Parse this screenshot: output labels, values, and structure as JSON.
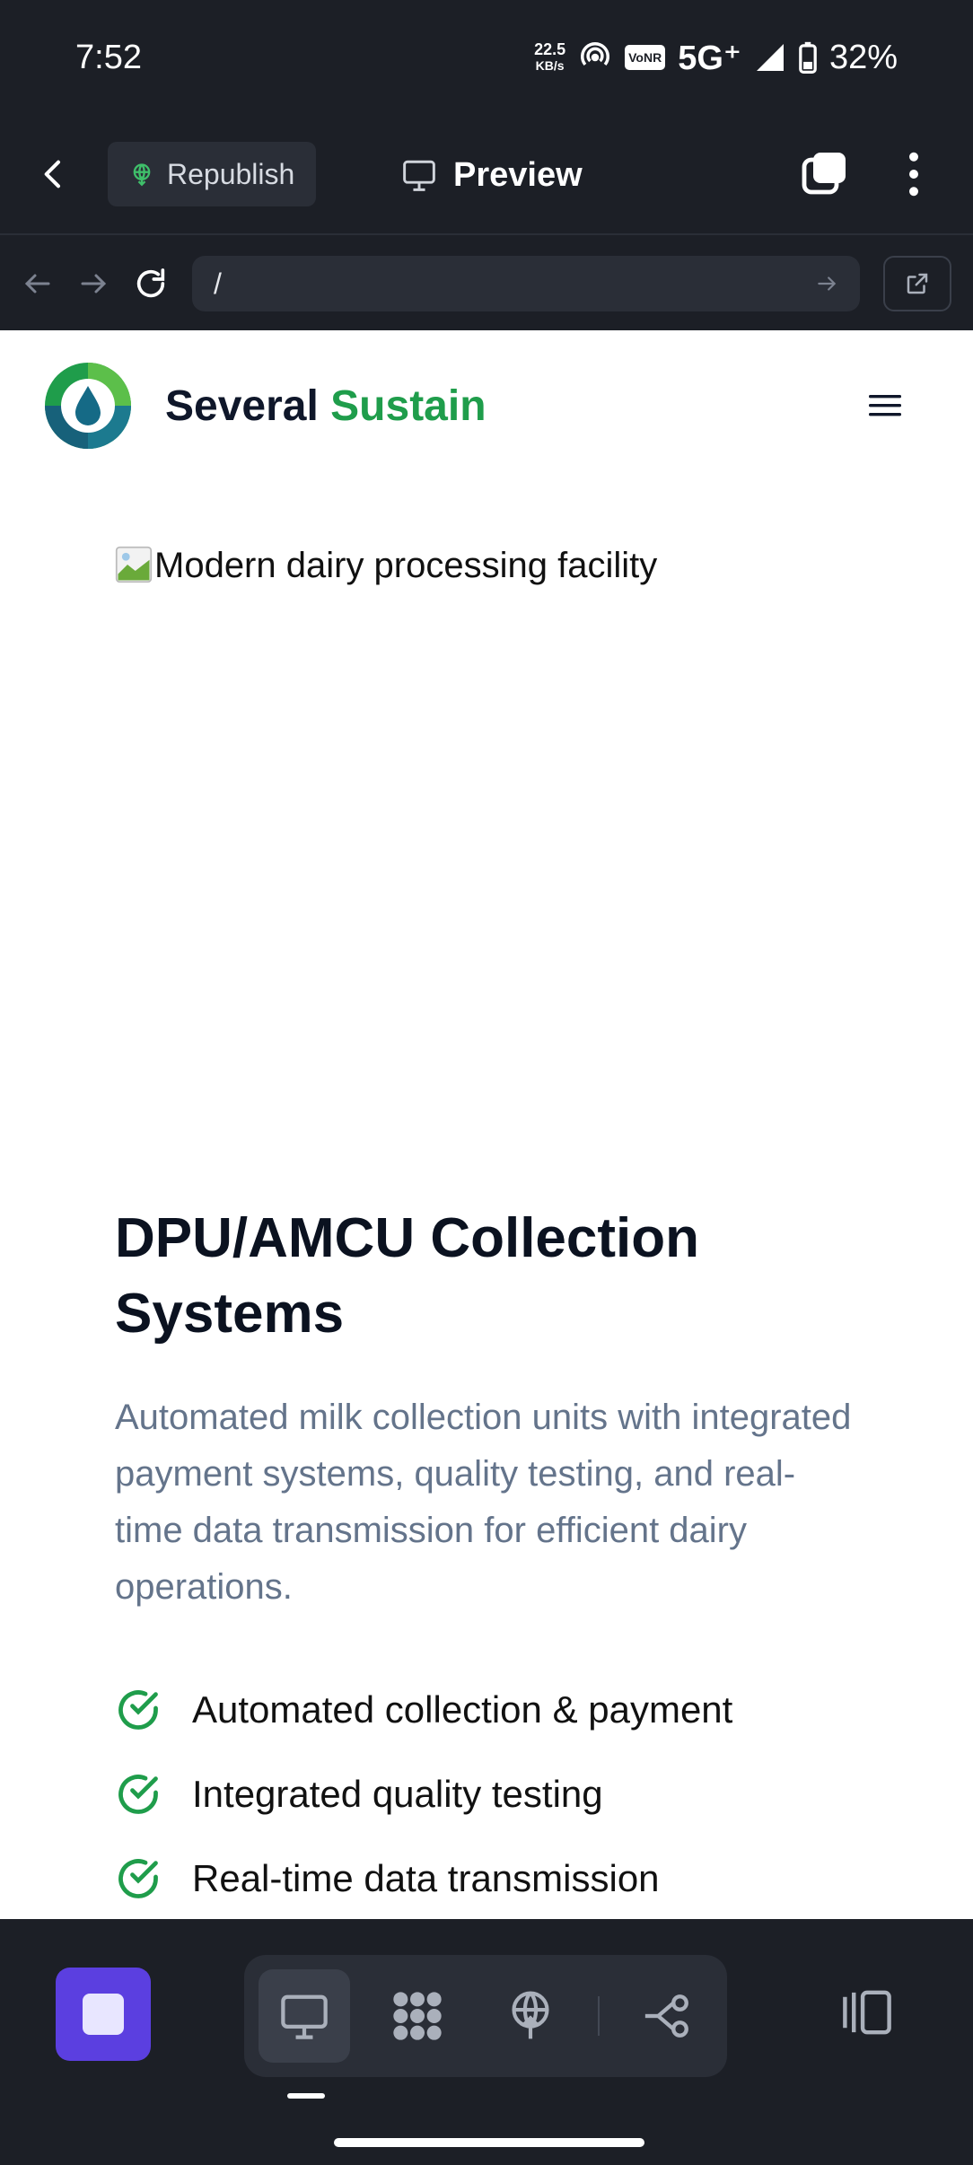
{
  "status_bar": {
    "time": "7:52",
    "speed_value": "22.5",
    "speed_unit": "KB/s",
    "vonr": "VoNR",
    "network": "5G⁺",
    "battery": "32%"
  },
  "app_bar": {
    "republish_label": "Republish",
    "preview_label": "Preview"
  },
  "url_bar": {
    "url": "/"
  },
  "site": {
    "brand_first": "Several",
    "brand_second": "Sustain",
    "hero_image_alt": "Modern dairy processing facility",
    "title": "DPU/AMCU Collection Systems",
    "description": "Automated milk collection units with integrated payment systems, quality testing, and real-time data transmission for efficient dairy operations.",
    "features": [
      "Automated collection & payment",
      "Integrated quality testing",
      "Real-time data transmission"
    ]
  },
  "colors": {
    "brand_green": "#1f9d4b",
    "stop_purple": "#5b3fe0",
    "dark_bg": "#1c1f26"
  }
}
